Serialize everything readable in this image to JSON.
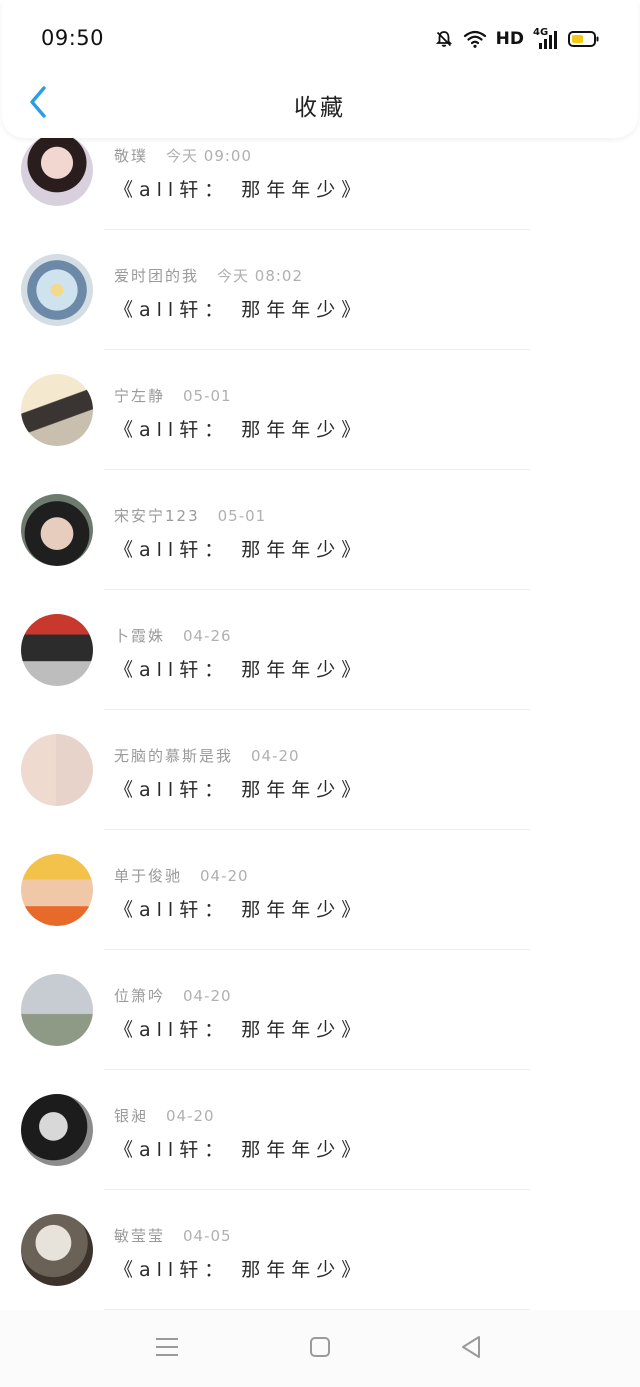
{
  "status_bar": {
    "time": "09:50",
    "network_label": "HD",
    "signal_label": "4G"
  },
  "header": {
    "title": "收藏",
    "accent_color": "#2b9ce6"
  },
  "items": [
    {
      "name": "敬璞",
      "date": "今天 09:00",
      "title": "《all轩： 那年年少》"
    },
    {
      "name": "爱时团的我",
      "date": "今天 08:02",
      "title": "《all轩： 那年年少》"
    },
    {
      "name": "宁左静",
      "date": "05-01",
      "title": "《all轩： 那年年少》"
    },
    {
      "name": "宋安宁123",
      "date": "05-01",
      "title": "《all轩： 那年年少》"
    },
    {
      "name": "卜霞姝",
      "date": "04-26",
      "title": "《all轩： 那年年少》"
    },
    {
      "name": "无脑的慕斯是我",
      "date": "04-20",
      "title": "《all轩： 那年年少》"
    },
    {
      "name": "单于俊驰",
      "date": "04-20",
      "title": "《all轩： 那年年少》"
    },
    {
      "name": "位箫吟",
      "date": "04-20",
      "title": "《all轩： 那年年少》"
    },
    {
      "name": "银昶",
      "date": "04-20",
      "title": "《all轩： 那年年少》"
    },
    {
      "name": "敏莹莹",
      "date": "04-05",
      "title": "《all轩： 那年年少》"
    }
  ],
  "bottom_nav": {
    "icons": [
      "menu-icon",
      "home-square-icon",
      "back-triangle-icon"
    ]
  }
}
